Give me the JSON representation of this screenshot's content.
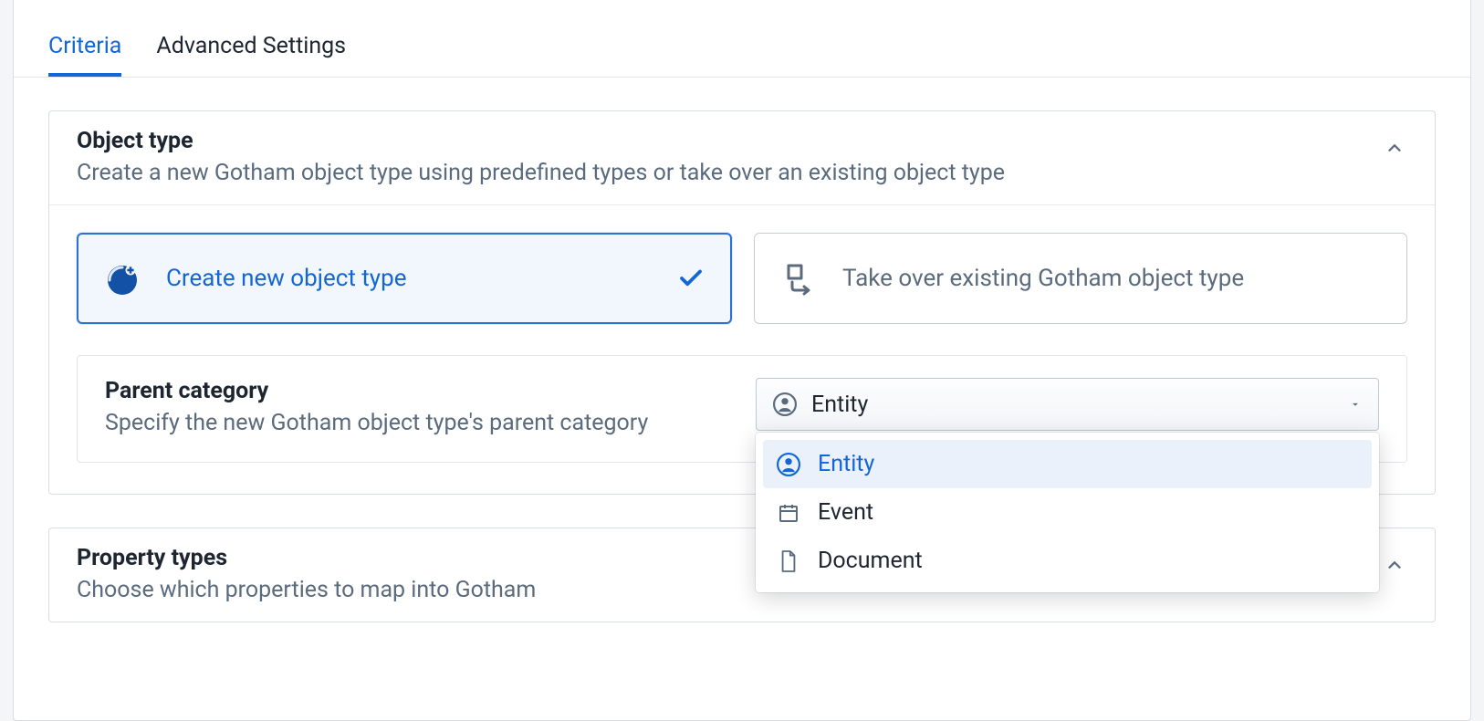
{
  "tabs": {
    "criteria": "Criteria",
    "advanced": "Advanced Settings"
  },
  "sections": {
    "object_type": {
      "title": "Object type",
      "subtitle": "Create a new Gotham object type using predefined types or take over an existing object type",
      "options": {
        "create_new": "Create new object type",
        "take_over": "Take over existing Gotham object type"
      },
      "parent_category": {
        "title": "Parent category",
        "subtitle": "Specify the new Gotham object type's parent category",
        "selected": "Entity",
        "items": {
          "entity": "Entity",
          "event": "Event",
          "document": "Document"
        }
      }
    },
    "property_types": {
      "title": "Property types",
      "subtitle": "Choose which properties to map into Gotham"
    }
  }
}
